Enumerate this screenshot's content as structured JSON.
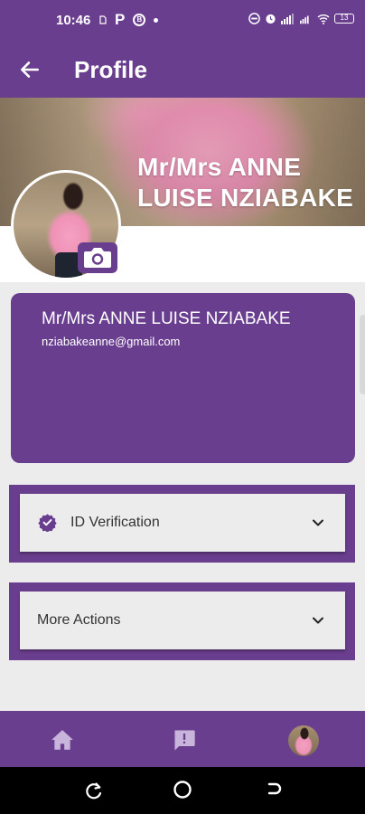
{
  "status_bar": {
    "time": "10:46",
    "left_icons": [
      "sim-icon",
      "parking-icon",
      "b-badge-icon",
      "dot-icon"
    ],
    "p_label": "P",
    "b_label": "B",
    "right_icons": [
      "dnd-icon",
      "alarm-icon",
      "signal-icon",
      "data-icon",
      "wifi-icon",
      "battery-icon"
    ],
    "battery_level": "13"
  },
  "app_bar": {
    "title": "Profile",
    "back_icon": "arrow-left-icon"
  },
  "cover": {
    "name": "Mr/Mrs ANNE LUISE  NZIABAKE"
  },
  "profile": {
    "name": "Mr/Mrs ANNE LUISE  NZIABAKE",
    "email": "nziabakeanne@gmail.com",
    "camera_icon": "camera-icon"
  },
  "sections": {
    "id_verification": {
      "label": "ID Verification",
      "icon": "verified-badge-icon"
    },
    "more_actions": {
      "label": "More Actions"
    }
  },
  "bottom_nav": {
    "items": [
      "home-icon",
      "feedback-icon",
      "profile-avatar"
    ]
  },
  "colors": {
    "primary": "#6a3e8e",
    "background": "#ececec"
  }
}
